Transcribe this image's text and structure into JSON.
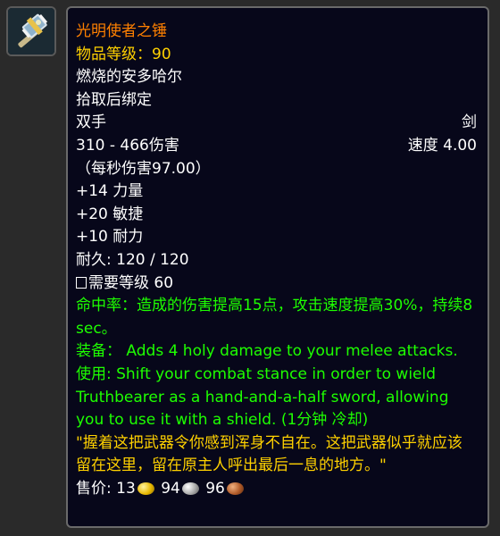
{
  "item": {
    "icon": "hammer-icon",
    "name": "光明使者之锤",
    "item_level": "物品等级：90",
    "source": "燃烧的安多哈尔",
    "binding": "拾取后绑定",
    "slot": "双手",
    "type": "剑",
    "damage": "310 - 466伤害",
    "speed": "速度 4.00",
    "dps": "（每秒伤害97.00）",
    "stats": [
      "+14 力量",
      "+20 敏捷",
      "+10 耐力"
    ],
    "durability": "耐久: 120 / 120",
    "requirement": "需要等级 60",
    "hit_effect": "命中率：造成的伤害提高15点，攻击速度提高30%，持续8 sec。",
    "equip_effect": "装备： Adds 4 holy damage to your melee attacks.",
    "use_effect": "使用: Shift your combat stance in order to wield Truthbearer as a hand-and-a-half sword, allowing you to use it with a shield. (1分钟 冷却)",
    "flavor": "\"握着这把武器令你感到浑身不自在。这把武器似乎就应该留在这里，留在原主人呼出最后一息的地方。\"",
    "sell_label": "售价:",
    "sell_gold": "13",
    "sell_silver": "94",
    "sell_copper": "96"
  },
  "colors": {
    "name": "#ff8000",
    "gold_text": "#ffd100",
    "effect_green": "#1eff00",
    "background": "#07071a"
  }
}
